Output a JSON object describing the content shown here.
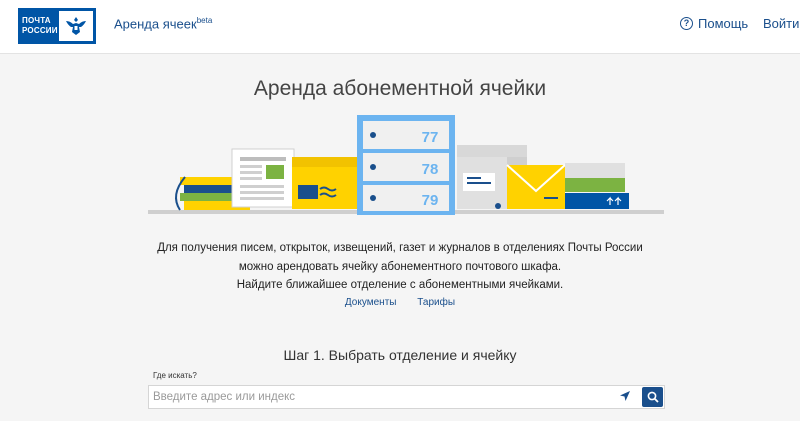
{
  "header": {
    "logo_line1": "ПОЧТА",
    "logo_line2": "РОССИИ",
    "app_title": "Аренда ячеек",
    "app_title_sup": "beta",
    "help_label": "Помощь",
    "help_icon": "?",
    "login_label": "Войти"
  },
  "main": {
    "title": "Аренда абонементной ячейки",
    "illustration": {
      "box_numbers": [
        "77",
        "78",
        "79"
      ]
    },
    "description": [
      "Для получения писем, открыток, извещений, газет и журналов в отделениях Почты России",
      "можно арендовать ячейку абонементного почтового шкафа.",
      "Найдите ближайшее отделение с абонементными ячейками."
    ],
    "links": {
      "documents": "Документы",
      "tariffs": "Тарифы"
    },
    "step_title": "Шаг 1. Выбрать отделение и ячейку",
    "search": {
      "label": "Где искать?",
      "placeholder": "Введите адрес или индекс",
      "value": ""
    }
  },
  "colors": {
    "brand_blue": "#0055a6",
    "link_blue": "#1a4f8c",
    "cabinet_blue": "#6cb4f0",
    "yellow": "#ffd200",
    "green": "#7cb342"
  },
  "icons": {
    "help": "question-circle-icon",
    "locate": "navigation-arrow-icon",
    "search": "magnifier-icon",
    "logo": "eagle-emblem-icon"
  }
}
